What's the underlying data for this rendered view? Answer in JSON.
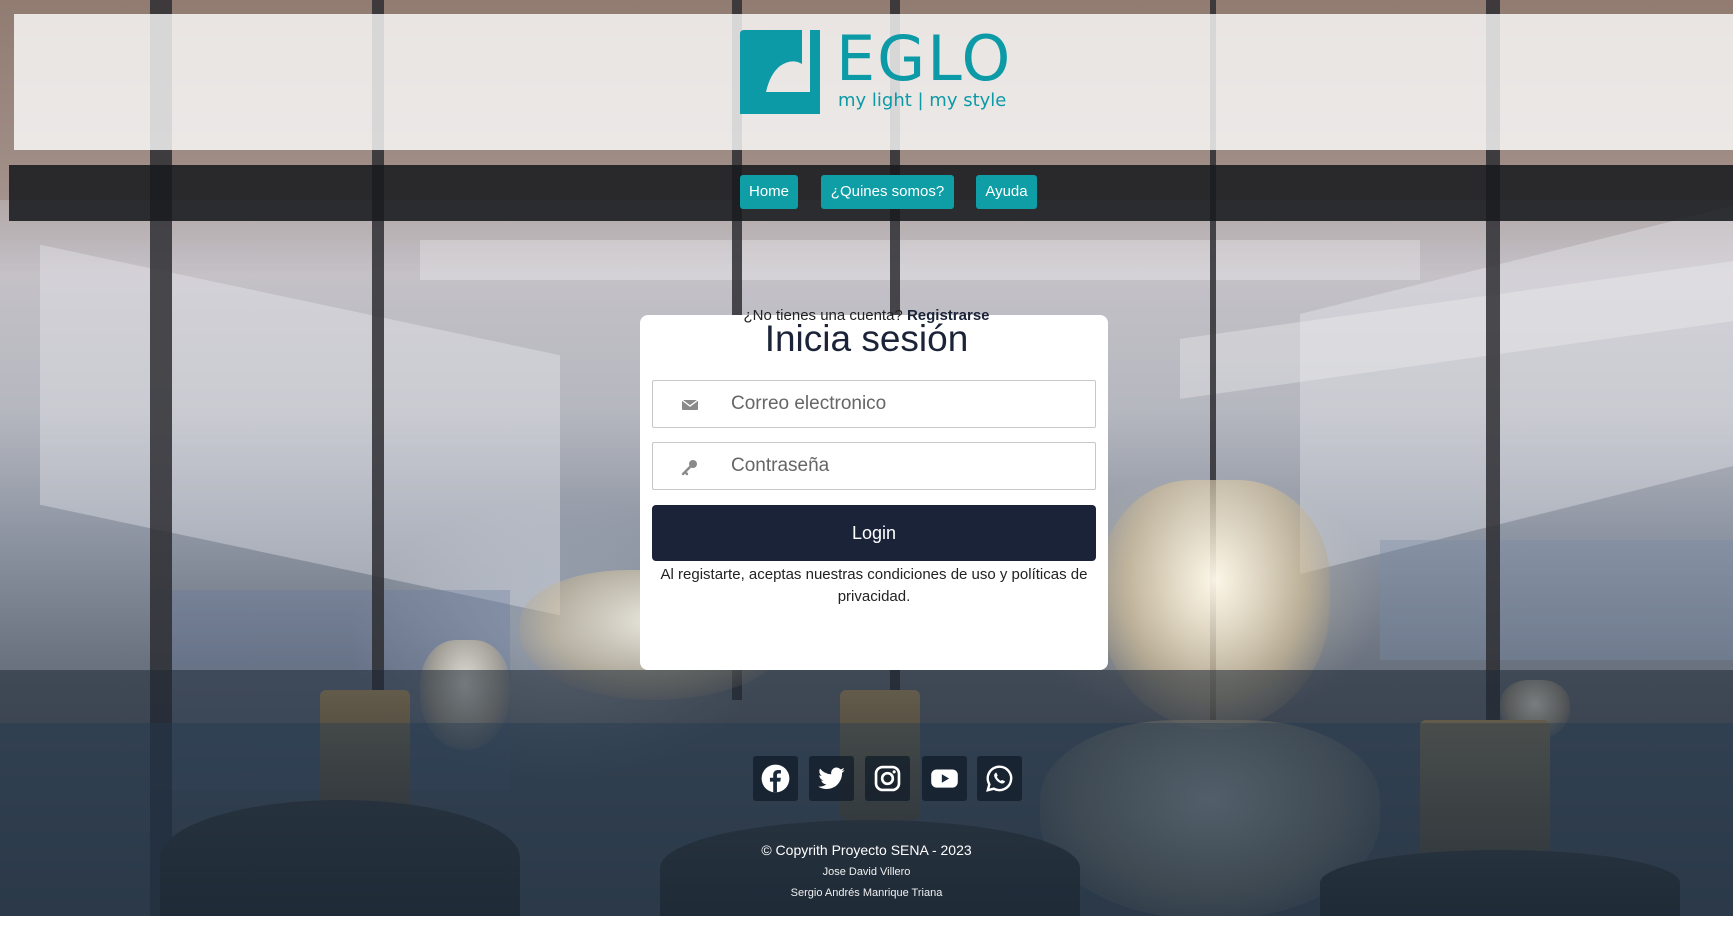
{
  "brand": {
    "name": "EGLO",
    "tagline": "my light | my style",
    "color": "#0b9aa6"
  },
  "nav": {
    "items": [
      {
        "label": "Home"
      },
      {
        "label": "¿Quines somos?"
      },
      {
        "label": "Ayuda"
      }
    ],
    "button_color": "#0f9ea6"
  },
  "login": {
    "title": "Inicia sesión",
    "email_placeholder": "Correo electronico",
    "email_icon": "envelope-icon",
    "password_placeholder": "Contraseña",
    "password_icon": "key-icon",
    "submit_label": "Login",
    "terms_text": "Al registarte, aceptas nuestras condiciones de uso y políticas de privacidad.",
    "signup_prompt": "¿No tienes una cuenta?",
    "signup_link": "Registrarse",
    "button_color": "#1b2338"
  },
  "footer": {
    "social": [
      {
        "icon": "facebook-icon"
      },
      {
        "icon": "twitter-icon"
      },
      {
        "icon": "instagram-icon"
      },
      {
        "icon": "youtube-icon"
      },
      {
        "icon": "whatsapp-icon"
      }
    ],
    "copyright": "© Copyrith Proyecto SENA - 2023",
    "authors": [
      "Jose David Villero",
      "Sergio Andrés Manrique Triana"
    ]
  }
}
